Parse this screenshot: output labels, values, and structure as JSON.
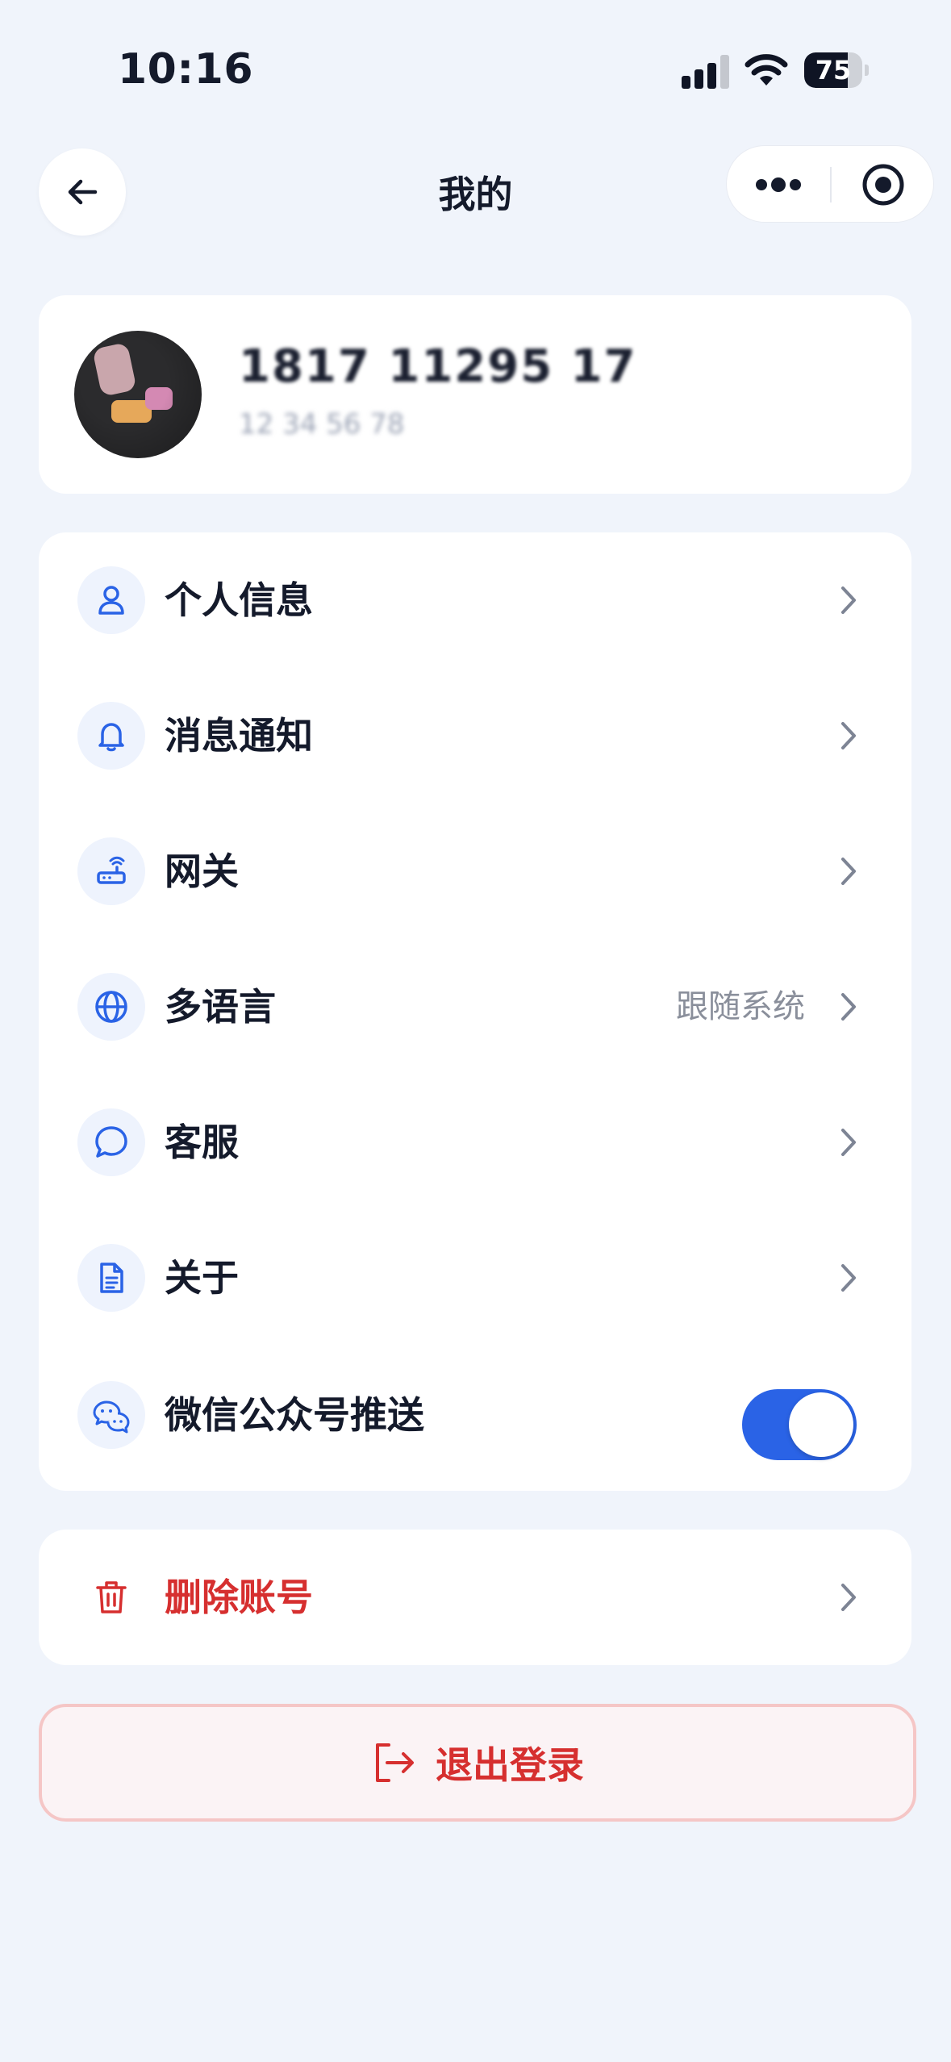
{
  "status_bar": {
    "time": "10:16",
    "battery_level": "75"
  },
  "nav": {
    "title": "我的"
  },
  "profile": {
    "name": "1817 11295 17",
    "subtitle": "12 34 56 78"
  },
  "menu": {
    "items": [
      {
        "label": "个人信息",
        "icon": "user-icon"
      },
      {
        "label": "消息通知",
        "icon": "bell-icon"
      },
      {
        "label": "网关",
        "icon": "router-icon"
      },
      {
        "label": "多语言",
        "icon": "globe-icon",
        "value": "跟随系统"
      },
      {
        "label": "客服",
        "icon": "chat-bubble-icon"
      },
      {
        "label": "关于",
        "icon": "document-icon"
      },
      {
        "label": "微信公众号推送",
        "icon": "wechat-icon",
        "toggle_on": true
      }
    ]
  },
  "danger": {
    "delete_label": "删除账号"
  },
  "logout": {
    "label": "退出登录"
  },
  "colors": {
    "accent": "#2a63e6",
    "danger": "#d62f2f",
    "background": "#f0f4fb"
  }
}
